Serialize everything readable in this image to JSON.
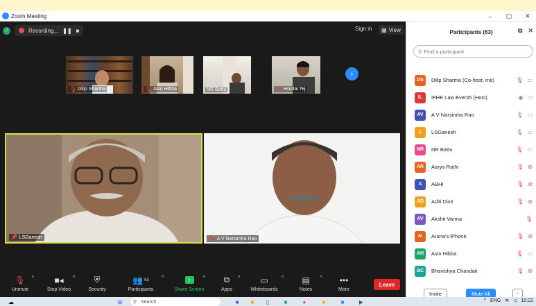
{
  "window": {
    "title": "Zoom Meeting",
    "controls": [
      "–",
      "▢",
      "✕"
    ]
  },
  "top_bar": {
    "recording_label": "Recording...",
    "pause_icon": "pause-icon",
    "stop_icon": "stop-icon",
    "signin_label": "Sign in",
    "view_label": "View"
  },
  "thumbnails": [
    {
      "name": "Dilip Sharma",
      "muted": true
    },
    {
      "name": "Asin Hibba",
      "muted": true
    },
    {
      "name": "NR Battu",
      "muted": false
    },
    {
      "name": "Hrudai Tej",
      "muted": true
    }
  ],
  "main_tiles": [
    {
      "name": "LSGanesh",
      "pinned": true,
      "active_speaker": true
    },
    {
      "name": "A V Narsimha Rao",
      "pinned": true,
      "active_speaker": false
    }
  ],
  "toolbar": {
    "unmute": "Unmute",
    "stop_video": "Stop Video",
    "security": "Security",
    "participants": "Participants",
    "participants_count": "63",
    "share_screen": "Share Screen",
    "apps": "Apps",
    "whiteboards": "Whiteboards",
    "notes": "Notes",
    "more": "More",
    "leave": "Leave"
  },
  "panel": {
    "title": "Participants (63)",
    "search_placeholder": "Find a participant",
    "participants": [
      {
        "initials": "DS",
        "name": "Dilip Sharma (Co-host, me)",
        "color": "#e8631f",
        "mic": "muted",
        "video": "on"
      },
      {
        "initials": "IL",
        "name": "IFHE Law Event5 (Host)",
        "color": "#d93b3b",
        "mic": "none",
        "video": "on"
      },
      {
        "initials": "AV",
        "name": "A V Narsimha Rao",
        "color": "#3f51b5",
        "mic": "unmuted",
        "video": "on"
      },
      {
        "initials": "L",
        "name": "LSGanesh",
        "color": "#f4a01c",
        "mic": "unmuted",
        "video": "on"
      },
      {
        "initials": "NR",
        "name": "NR Battu",
        "color": "#e64a8f",
        "mic": "muted",
        "video": "on"
      },
      {
        "initials": "AR",
        "name": "Aarya Rathi",
        "color": "#e8631f",
        "mic": "muted",
        "video": "off"
      },
      {
        "initials": "A",
        "name": "ABHI",
        "color": "#3f51b5",
        "mic": "muted",
        "video": "off"
      },
      {
        "initials": "AD",
        "name": "Aditi Dixit",
        "color": "#f4a01c",
        "mic": "muted",
        "video": "off"
      },
      {
        "initials": "AV",
        "name": "Akshit Varma",
        "color": "#7e57c2",
        "mic": "muted",
        "video": "none"
      },
      {
        "initials": "AI",
        "name": "Aruna's iPhone",
        "color": "#e8631f",
        "mic": "muted",
        "video": "off"
      },
      {
        "initials": "AH",
        "name": "Asin Hibba",
        "color": "#21a366",
        "mic": "muted",
        "video": "on"
      },
      {
        "initials": "BC",
        "name": "Bhavishya Chandak",
        "color": "#1aa59b",
        "mic": "muted",
        "video": "off"
      }
    ],
    "invite_label": "Invite",
    "mute_all_label": "Mute All",
    "more_label": "···"
  },
  "taskbar": {
    "search_placeholder": "Search",
    "language": "ENG",
    "time": "10:22"
  },
  "colors": {
    "accent": "#2d8cff",
    "leave": "#e02828",
    "active_border": "#d8e04a",
    "share_green": "#21c361"
  }
}
